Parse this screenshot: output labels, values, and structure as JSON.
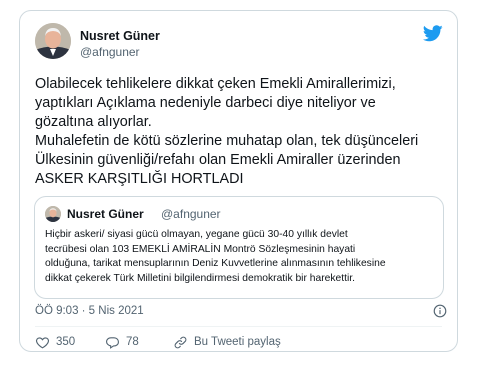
{
  "author": {
    "name": "Nusret Güner",
    "handle": "@afnguner"
  },
  "tweet": {
    "lines": [
      "Olabilecek tehlikelere dikkat çeken Emekli Amirallerimizi,",
      "yaptıkları Açıklama nedeniyle darbeci diye niteliyor ve",
      "gözaltına alıyorlar.",
      "Muhalefetin de kötü sözlerine muhatap olan, tek düşünceleri",
      "Ülkesinin güvenliği/refahı olan Emekli Amiraller üzerinden",
      "ASKER KARŞITLIĞI HORTLADI"
    ]
  },
  "quote": {
    "name": "Nusret Güner",
    "handle": "@afnguner",
    "lines": [
      "Hiçbir askeri/ siyasi gücü olmayan, yegane gücü 30-40 yıllık devlet",
      "tecrübesi olan 103 EMEKLİ AMİRALİN Montrö Sözleşmesinin hayati",
      "olduğuna, tarikat mensuplarının Deniz Kuvvetlerine alınmasının tehlikesine",
      "dikkat çekerek Türk Milletini bilgilendirmesi demokratik bir harekettir."
    ]
  },
  "timestamp": "ÖÖ 9:03 · 5 Nis 2021",
  "actions": {
    "likes": "350",
    "replies": "78",
    "share": "Bu Tweeti paylaş"
  },
  "colors": {
    "twitter_blue": "#1d9bf0",
    "secondary_text": "#536471",
    "border": "#cfd9de"
  },
  "icons": [
    "twitter-bird-icon",
    "info-icon",
    "heart-icon",
    "reply-icon",
    "share-icon"
  ]
}
